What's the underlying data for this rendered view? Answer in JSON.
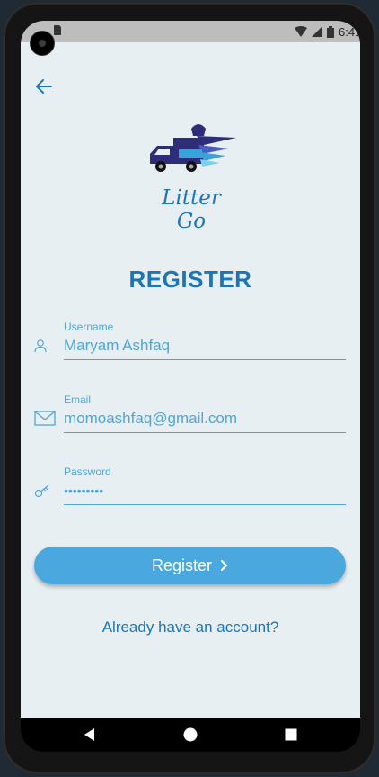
{
  "status_bar": {
    "time": "6:41"
  },
  "app": {
    "logo_text": "Litter Go",
    "title": "REGISTER"
  },
  "form": {
    "username": {
      "label": "Username",
      "value": "Maryam Ashfaq",
      "icon": "user-icon"
    },
    "email": {
      "label": "Email",
      "value": "momoashfaq@gmail.com",
      "icon": "mail-icon"
    },
    "password": {
      "label": "Password",
      "value": "•••••••••",
      "icon": "key-icon"
    }
  },
  "actions": {
    "register_label": "Register",
    "login_link": "Already have an account?"
  },
  "colors": {
    "primary": "#1d75b5",
    "accent": "#4aa8df",
    "background": "#e8eff2"
  }
}
